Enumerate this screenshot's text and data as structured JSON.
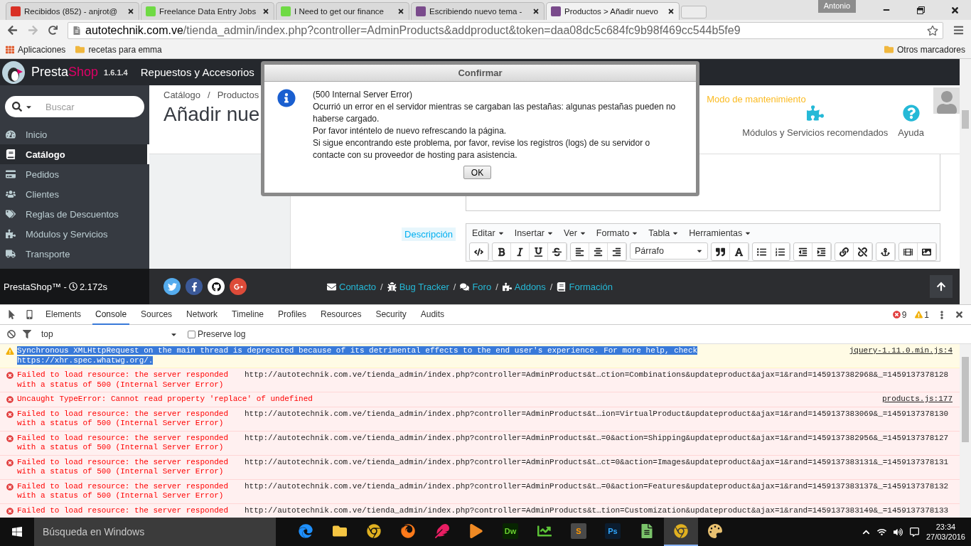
{
  "browser": {
    "tabs": [
      {
        "title": "Recibidos (852) - anjrot@",
        "kind": "mail",
        "selected": false
      },
      {
        "title": "Freelance Data Entry Jobs",
        "kind": "up",
        "selected": false
      },
      {
        "title": "I Need to get our finance",
        "kind": "up",
        "selected": false
      },
      {
        "title": "Escribiendo nuevo tema -",
        "kind": "bird",
        "selected": false
      },
      {
        "title": "Productos > Añadir nuevo",
        "kind": "bird",
        "selected": true
      }
    ],
    "profile": "Antonio",
    "url": {
      "host": "autotechnik.com.ve",
      "path": "/tienda_admin/index.php?controller=AdminProducts&addproduct&token=daa08dc5c684fc9b98f469cc544b5fe9"
    },
    "bookmarks": [
      {
        "label": "Aplicaciones",
        "kind": "apps"
      },
      {
        "label": "recetas para emma",
        "kind": "folder"
      }
    ],
    "other_bookmarks": "Otros marcadores"
  },
  "app": {
    "brand_a": "Presta",
    "brand_b": "Shop",
    "version": "1.6.1.4",
    "shop_name": "Repuestos y Accesorios",
    "search": {
      "placeholder": "Buscar"
    },
    "menu": [
      {
        "label": "Inicio",
        "kind": "dashboard",
        "selected": false
      },
      {
        "label": "Catálogo",
        "kind": "book",
        "selected": true
      },
      {
        "label": "Pedidos",
        "kind": "card",
        "selected": false
      },
      {
        "label": "Clientes",
        "kind": "users",
        "selected": false
      },
      {
        "label": "Reglas de Descuentos",
        "kind": "tags",
        "selected": false
      },
      {
        "label": "Módulos y Servicios",
        "kind": "puzzle",
        "selected": false
      },
      {
        "label": "Transporte",
        "kind": "truck",
        "selected": false
      }
    ],
    "breadcrumb": [
      "Catálogo",
      "/",
      "Productos"
    ],
    "page_title": "Añadir nue",
    "maintenance": "Modo de mantenimiento",
    "header_actions": [
      {
        "label": "Módulos y Servicios recomendados",
        "kind": "puzzle"
      },
      {
        "label": "Ayuda",
        "kind": "help"
      }
    ],
    "field_label": "Descripción",
    "editor": {
      "menus": [
        "Editar",
        "Insertar",
        "Ver",
        "Formato",
        "Tabla",
        "Herramientas"
      ],
      "format": "Párrafo"
    },
    "footer": {
      "credit": "PrestaShop™ -",
      "time": "2.172s",
      "social": [
        {
          "kind": "twitter"
        },
        {
          "kind": "facebook"
        },
        {
          "kind": "github"
        },
        {
          "kind": "google"
        }
      ],
      "separator": "/",
      "links": [
        {
          "label": "Contacto",
          "kind": "mail"
        },
        {
          "label": "Bug Tracker",
          "kind": "bug"
        },
        {
          "label": "Foro",
          "kind": "comments"
        },
        {
          "label": "Addons",
          "kind": "puzzle"
        },
        {
          "label": "Formación",
          "kind": "book"
        }
      ]
    }
  },
  "dialog": {
    "title": "Confirmar",
    "lines": [
      "(500 Internal Server Error)",
      "Ocurrió un error en el servidor mientras se cargaban las pestañas: algunas pestañas pueden no haberse cargado.",
      "Por favor inténtelo de nuevo refrescando la página.",
      "Si sigue encontrando este problema, por favor, revise los registros (logs) de su servidor o contacte con su proveedor de hosting para asistencia."
    ],
    "button": "OK"
  },
  "devtools": {
    "tabs": [
      {
        "label": "Elements",
        "selected": false
      },
      {
        "label": "Console",
        "selected": true
      },
      {
        "label": "Sources",
        "selected": false
      },
      {
        "label": "Network",
        "selected": false
      },
      {
        "label": "Timeline",
        "selected": false
      },
      {
        "label": "Profiles",
        "selected": false
      },
      {
        "label": "Resources",
        "selected": false
      },
      {
        "label": "Security",
        "selected": false
      },
      {
        "label": "Audits",
        "selected": false
      }
    ],
    "error_count": "9",
    "warning_count": "1",
    "context": "top",
    "preserve_log": {
      "label": "Preserve log",
      "checked": false
    },
    "messages": [
      {
        "kind": "warning",
        "selected": true,
        "text": "Synchronous XMLHttpRequest on the main thread is deprecated because of its detrimental effects to the end user's experience. For more help, check https://xhr.spec.whatwg.org/.",
        "source": "jquery-1.11.0.min.js:4"
      },
      {
        "kind": "error",
        "selected": false,
        "text": "Failed to load resource: the server responded with a status of 500 (Internal Server Error)",
        "url": "http://autotechnik.com.ve/tienda_admin/index.php?controller=AdminProducts&t…ction=Combinations&updateproduct&ajax=1&rand=1459137382968&_=1459137378128"
      },
      {
        "kind": "error",
        "selected": false,
        "text": "Uncaught TypeError: Cannot read property 'replace' of undefined",
        "source": "products.js:177"
      },
      {
        "kind": "error",
        "selected": false,
        "text": "Failed to load resource: the server responded with a status of 500 (Internal Server Error)",
        "url": "http://autotechnik.com.ve/tienda_admin/index.php?controller=AdminProducts&t…ion=VirtualProduct&updateproduct&ajax=1&rand=1459137383069&_=1459137378130"
      },
      {
        "kind": "error",
        "selected": false,
        "text": "Failed to load resource: the server responded with a status of 500 (Internal Server Error)",
        "url": "http://autotechnik.com.ve/tienda_admin/index.php?controller=AdminProducts&t…=0&action=Shipping&updateproduct&ajax=1&rand=1459137382956&_=1459137378127"
      },
      {
        "kind": "error",
        "selected": false,
        "text": "Failed to load resource: the server responded with a status of 500 (Internal Server Error)",
        "url": "http://autotechnik.com.ve/tienda_admin/index.php?controller=AdminProducts&t…ct=0&action=Images&updateproduct&ajax=1&rand=1459137383131&_=1459137378131"
      },
      {
        "kind": "error",
        "selected": false,
        "text": "Failed to load resource: the server responded with a status of 500 (Internal Server Error)",
        "url": "http://autotechnik.com.ve/tienda_admin/index.php?controller=AdminProducts&t…=0&action=Features&updateproduct&ajax=1&rand=1459137383137&_=1459137378132"
      },
      {
        "kind": "error",
        "selected": false,
        "text": "Failed to load resource: the server responded",
        "url": "http://autotechnik.com.ve/tienda_admin/index.php?controller=AdminProducts&t…tion=Customization&updateproduct&ajax=1&rand=1459137383149&_=1459137378133"
      }
    ]
  },
  "taskbar": {
    "search_placeholder": "Búsqueda en Windows",
    "apps": [
      {
        "kind": "edge",
        "active": false
      },
      {
        "kind": "explorer",
        "active": false
      },
      {
        "kind": "chrome",
        "active": false
      },
      {
        "kind": "firefox",
        "active": false
      },
      {
        "kind": "pink",
        "active": false
      },
      {
        "kind": "player",
        "active": false
      },
      {
        "kind": "dw",
        "label": "Dw",
        "active": false
      },
      {
        "kind": "corel",
        "active": false
      },
      {
        "kind": "sublime",
        "label": "S",
        "active": false
      },
      {
        "kind": "ps",
        "label": "Ps",
        "active": false
      },
      {
        "kind": "chart",
        "active": false
      },
      {
        "kind": "chrome",
        "active": true
      },
      {
        "kind": "paint",
        "active": false
      }
    ],
    "time": "23:34",
    "date": "27/03/2016"
  }
}
